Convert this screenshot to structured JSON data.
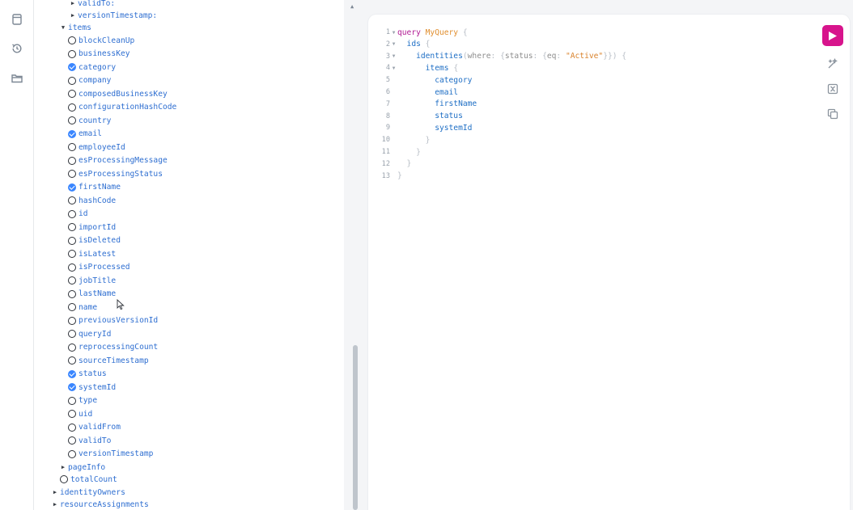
{
  "explorer": {
    "top_rows": [
      {
        "label": "validTo:",
        "level": 2,
        "type": "parent"
      },
      {
        "label": "versionTimestamp:",
        "level": 2,
        "type": "parent"
      },
      {
        "label": "items",
        "level": 1,
        "type": "expanded"
      }
    ],
    "items_fields": [
      {
        "label": "blockCleanUp",
        "checked": false
      },
      {
        "label": "businessKey",
        "checked": false
      },
      {
        "label": "category",
        "checked": true
      },
      {
        "label": "company",
        "checked": false
      },
      {
        "label": "composedBusinessKey",
        "checked": false
      },
      {
        "label": "configurationHashCode",
        "checked": false
      },
      {
        "label": "country",
        "checked": false
      },
      {
        "label": "email",
        "checked": true
      },
      {
        "label": "employeeId",
        "checked": false
      },
      {
        "label": "esProcessingMessage",
        "checked": false
      },
      {
        "label": "esProcessingStatus",
        "checked": false
      },
      {
        "label": "firstName",
        "checked": true
      },
      {
        "label": "hashCode",
        "checked": false
      },
      {
        "label": "id",
        "checked": false
      },
      {
        "label": "importId",
        "checked": false
      },
      {
        "label": "isDeleted",
        "checked": false
      },
      {
        "label": "isLatest",
        "checked": false
      },
      {
        "label": "isProcessed",
        "checked": false
      },
      {
        "label": "jobTitle",
        "checked": false
      },
      {
        "label": "lastName",
        "checked": false
      },
      {
        "label": "name",
        "checked": false
      },
      {
        "label": "previousVersionId",
        "checked": false
      },
      {
        "label": "queryId",
        "checked": false
      },
      {
        "label": "reprocessingCount",
        "checked": false
      },
      {
        "label": "sourceTimestamp",
        "checked": false
      },
      {
        "label": "status",
        "checked": true
      },
      {
        "label": "systemId",
        "checked": true
      },
      {
        "label": "type",
        "checked": false
      },
      {
        "label": "uid",
        "checked": false
      },
      {
        "label": "validFrom",
        "checked": false
      },
      {
        "label": "validTo",
        "checked": false
      },
      {
        "label": "versionTimestamp",
        "checked": false
      }
    ],
    "bottom_rows": [
      {
        "label": "pageInfo",
        "type": "collapsed"
      },
      {
        "label": "totalCount",
        "type": "field"
      },
      {
        "label": "identityOwners",
        "type": "collapsed"
      },
      {
        "label": "resourceAssignments",
        "type": "collapsed"
      }
    ]
  },
  "editor": {
    "lines": [
      {
        "n": "1",
        "fold": true,
        "tokens": [
          [
            "kw",
            "query "
          ],
          [
            "def",
            "MyQuery"
          ],
          [
            "punct",
            " {"
          ]
        ]
      },
      {
        "n": "2",
        "fold": true,
        "tokens": [
          [
            "field",
            "  ids"
          ],
          [
            "punct",
            " {"
          ]
        ]
      },
      {
        "n": "3",
        "fold": true,
        "tokens": [
          [
            "field",
            "    identities"
          ],
          [
            "punct",
            "("
          ],
          [
            "attr",
            "where"
          ],
          [
            "punct",
            ": {"
          ],
          [
            "attr",
            "status"
          ],
          [
            "punct",
            ": {"
          ],
          [
            "attr",
            "eq"
          ],
          [
            "punct",
            ": "
          ],
          [
            "str",
            "\"Active\""
          ],
          [
            "punct",
            "}}) {"
          ]
        ]
      },
      {
        "n": "4",
        "fold": true,
        "tokens": [
          [
            "field",
            "      items"
          ],
          [
            "punct",
            " {"
          ]
        ]
      },
      {
        "n": "5",
        "fold": false,
        "tokens": [
          [
            "field",
            "        category"
          ]
        ]
      },
      {
        "n": "6",
        "fold": false,
        "tokens": [
          [
            "field",
            "        email"
          ]
        ]
      },
      {
        "n": "7",
        "fold": false,
        "tokens": [
          [
            "field",
            "        firstName"
          ]
        ]
      },
      {
        "n": "8",
        "fold": false,
        "tokens": [
          [
            "field",
            "        status"
          ]
        ]
      },
      {
        "n": "9",
        "fold": false,
        "tokens": [
          [
            "field",
            "        systemId"
          ]
        ]
      },
      {
        "n": "10",
        "fold": false,
        "tokens": [
          [
            "punct",
            "      }"
          ]
        ]
      },
      {
        "n": "11",
        "fold": false,
        "tokens": [
          [
            "punct",
            "    }"
          ]
        ]
      },
      {
        "n": "12",
        "fold": false,
        "tokens": [
          [
            "punct",
            "  }"
          ]
        ]
      },
      {
        "n": "13",
        "fold": false,
        "tokens": [
          [
            "punct",
            "}"
          ]
        ]
      }
    ]
  },
  "colors": {
    "run_button": "#d7148c",
    "checkbox_on": "#3a86ff",
    "field_text": "#2f6fd1",
    "keyword": "#b11a94",
    "operation_name": "#e08e2e"
  },
  "icons": {
    "rail": [
      "docs-icon",
      "history-icon",
      "folder-icon"
    ],
    "toolbar": [
      "play-icon",
      "prettify-icon",
      "merge-icon",
      "copy-icon"
    ]
  }
}
